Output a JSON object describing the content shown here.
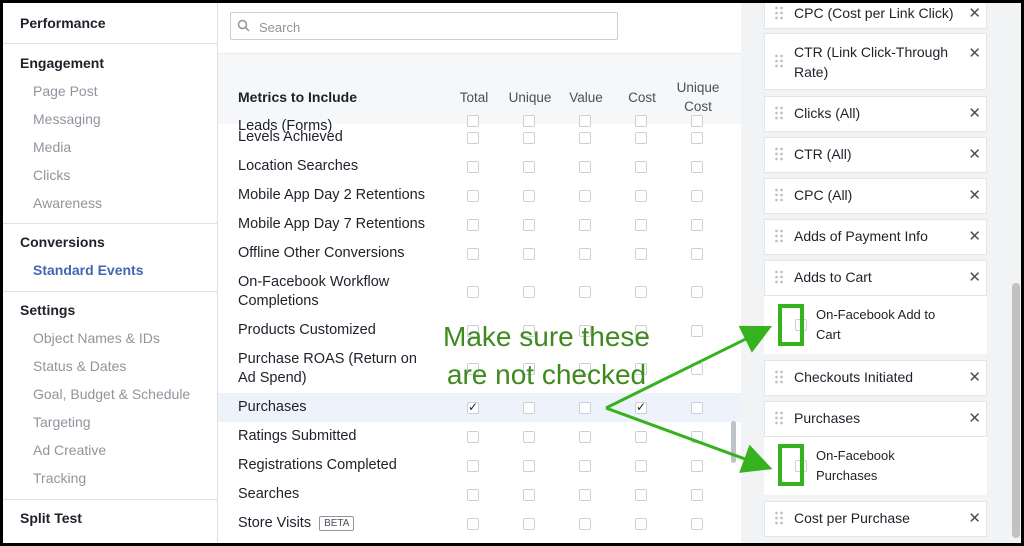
{
  "left_nav": {
    "sections": [
      {
        "title": "Performance",
        "items": []
      },
      {
        "title": "Engagement",
        "items": [
          "Page Post",
          "Messaging",
          "Media",
          "Clicks",
          "Awareness"
        ]
      },
      {
        "title": "Conversions",
        "items": [
          "Standard Events"
        ],
        "active_item": "Standard Events"
      },
      {
        "title": "Settings",
        "items": [
          "Object Names & IDs",
          "Status & Dates",
          "Goal, Budget & Schedule",
          "Targeting",
          "Ad Creative",
          "Tracking"
        ]
      },
      {
        "title": "Split Test",
        "items": []
      }
    ]
  },
  "search": {
    "placeholder": "Search",
    "value": ""
  },
  "table": {
    "headers": {
      "metrics": "Metrics to Include",
      "total": "Total",
      "unique": "Unique",
      "value": "Value",
      "cost": "Cost",
      "unique_cost": "Unique Cost"
    },
    "rows": [
      {
        "label": "Leads (Forms)",
        "checked": [
          false,
          false,
          false,
          false,
          false
        ]
      },
      {
        "label": "Levels Achieved",
        "checked": [
          false,
          false,
          false,
          false,
          false
        ]
      },
      {
        "label": "Location Searches",
        "checked": [
          false,
          false,
          false,
          false,
          false
        ]
      },
      {
        "label": "Mobile App Day 2 Retentions",
        "checked": [
          false,
          false,
          false,
          false,
          false
        ]
      },
      {
        "label": "Mobile App Day 7 Retentions",
        "checked": [
          false,
          false,
          false,
          false,
          false
        ]
      },
      {
        "label": "Offline Other Conversions",
        "checked": [
          false,
          false,
          false,
          false,
          false
        ]
      },
      {
        "label": "On-Facebook Workflow Completions",
        "checked": [
          false,
          false,
          false,
          false,
          false
        ]
      },
      {
        "label": "Products Customized",
        "checked": [
          false,
          false,
          false,
          false,
          false
        ]
      },
      {
        "label": "Purchase ROAS (Return on Ad Spend)",
        "checked": [
          false,
          false,
          false,
          false,
          false
        ]
      },
      {
        "label": "Purchases",
        "checked": [
          true,
          false,
          false,
          true,
          false
        ],
        "highlighted": true
      },
      {
        "label": "Ratings Submitted",
        "checked": [
          false,
          false,
          false,
          false,
          false
        ]
      },
      {
        "label": "Registrations Completed",
        "checked": [
          false,
          false,
          false,
          false,
          false
        ]
      },
      {
        "label": "Searches",
        "checked": [
          false,
          false,
          false,
          false,
          false
        ]
      },
      {
        "label": "Store Visits",
        "badge": "BETA",
        "checked": [
          false,
          false,
          false,
          false,
          false
        ]
      }
    ]
  },
  "selected_columns": {
    "cards": [
      {
        "label": "CPC (Cost per Link Click)"
      },
      {
        "label": "CTR (Link Click-Through Rate)"
      },
      {
        "label": "Clicks (All)"
      },
      {
        "label": "CTR (All)"
      },
      {
        "label": "CPC (All)"
      },
      {
        "label": "Adds of Payment Info"
      },
      {
        "label": "Adds to Cart"
      },
      {
        "label": "On-Facebook Add to Cart",
        "sub_option": true,
        "checked": false
      },
      {
        "label": "Checkouts Initiated"
      },
      {
        "label": "Purchases"
      },
      {
        "label": "On-Facebook Purchases",
        "sub_option": true,
        "checked": false
      },
      {
        "label": "Cost per Purchase"
      }
    ],
    "remove_glyph": "✕"
  },
  "annotation": {
    "line1": "Make sure these",
    "line2": "are not checked",
    "color": "#36b21f"
  },
  "colors": {
    "accent": "#4267b2",
    "annotation_green": "#36b21f"
  }
}
